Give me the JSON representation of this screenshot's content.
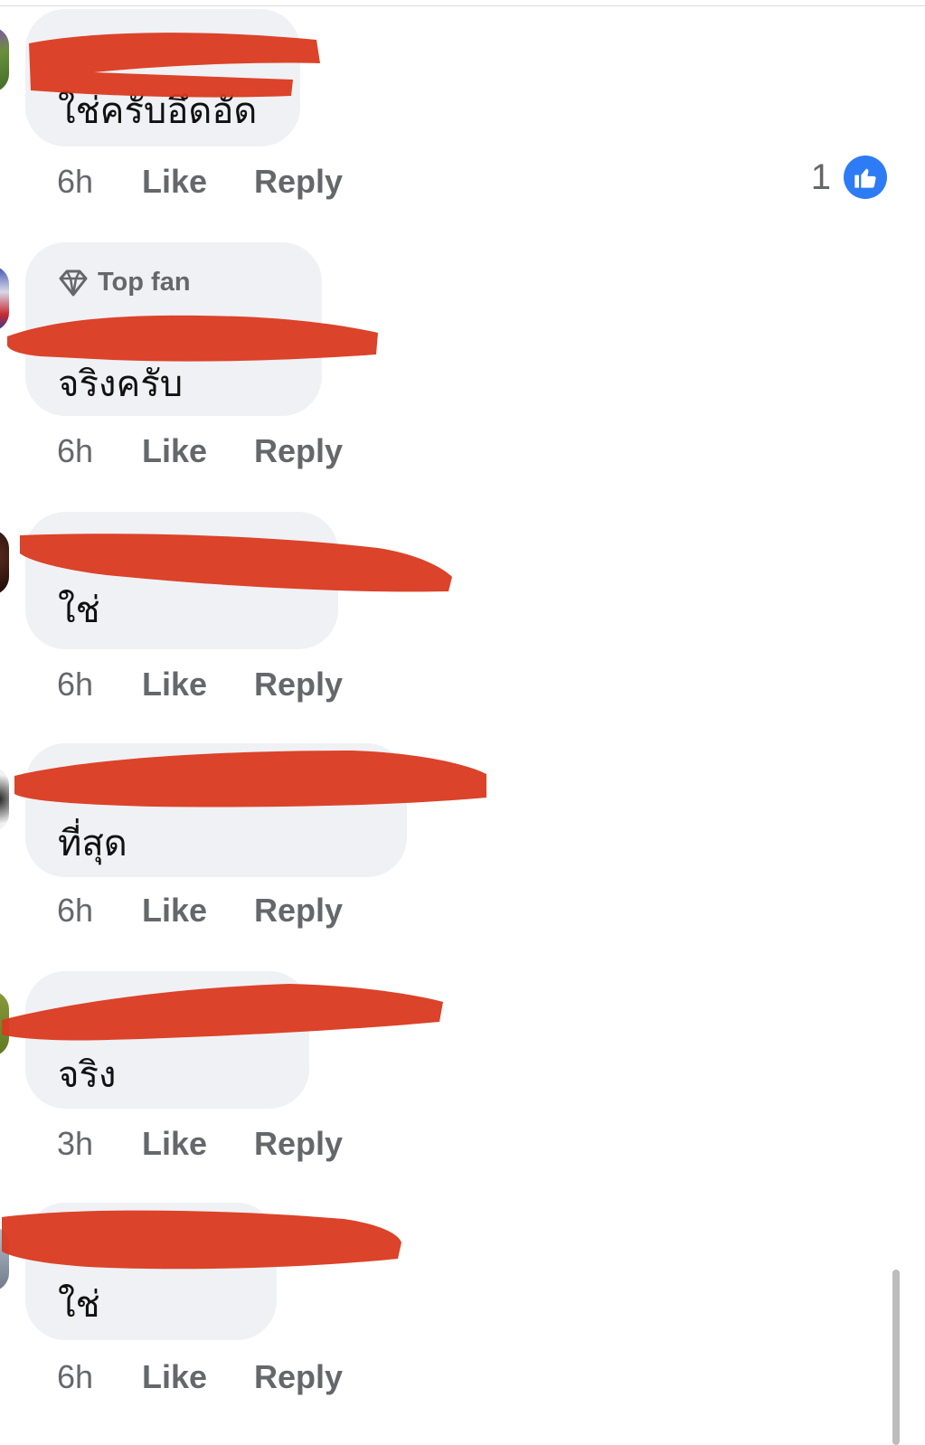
{
  "colors": {
    "bubble": "#f0f1f4",
    "meta_text": "#65676b",
    "redaction": "#d9391f",
    "like_badge": "#2d7cf6"
  },
  "comments": [
    {
      "text": "ใช่ครับอึดอัด",
      "time": "6h",
      "like_label": "Like",
      "reply_label": "Reply",
      "reaction_count": "1",
      "reaction_icon": "thumbs-up-icon"
    },
    {
      "badge_label": "Top fan",
      "badge_icon": "diamond-icon",
      "text": "จริงครับ",
      "time": "6h",
      "like_label": "Like",
      "reply_label": "Reply"
    },
    {
      "text": "ใช่",
      "time": "6h",
      "like_label": "Like",
      "reply_label": "Reply"
    },
    {
      "text": "ที่สุด",
      "time": "6h",
      "like_label": "Like",
      "reply_label": "Reply"
    },
    {
      "text": "จริง",
      "time": "3h",
      "like_label": "Like",
      "reply_label": "Reply"
    },
    {
      "text": "ใช่",
      "time": "6h",
      "like_label": "Like",
      "reply_label": "Reply"
    }
  ]
}
